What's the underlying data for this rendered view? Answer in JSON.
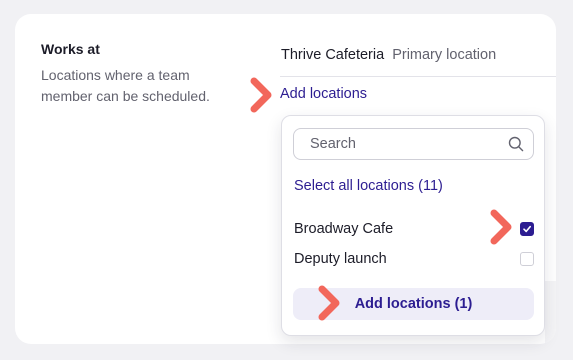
{
  "works_at": {
    "title": "Works at",
    "description": "Locations where a team member can be scheduled."
  },
  "current_location": {
    "name": "Thrive Cafeteria",
    "tag": "Primary location"
  },
  "add_locations_link": "Add locations",
  "dropdown": {
    "search_placeholder": "Search",
    "select_all_label": "Select all locations (11)",
    "options": [
      {
        "label": "Broadway Cafe",
        "checked": true
      },
      {
        "label": "Deputy launch",
        "checked": false
      }
    ],
    "submit_label": "Add locations (1)"
  },
  "colors": {
    "accent": "#2c1d91",
    "annotation_arrow": "#f2675b"
  },
  "icons": {
    "search": "search-icon",
    "checkmark": "check-icon",
    "annotation": "pointer-arrow-icon"
  }
}
